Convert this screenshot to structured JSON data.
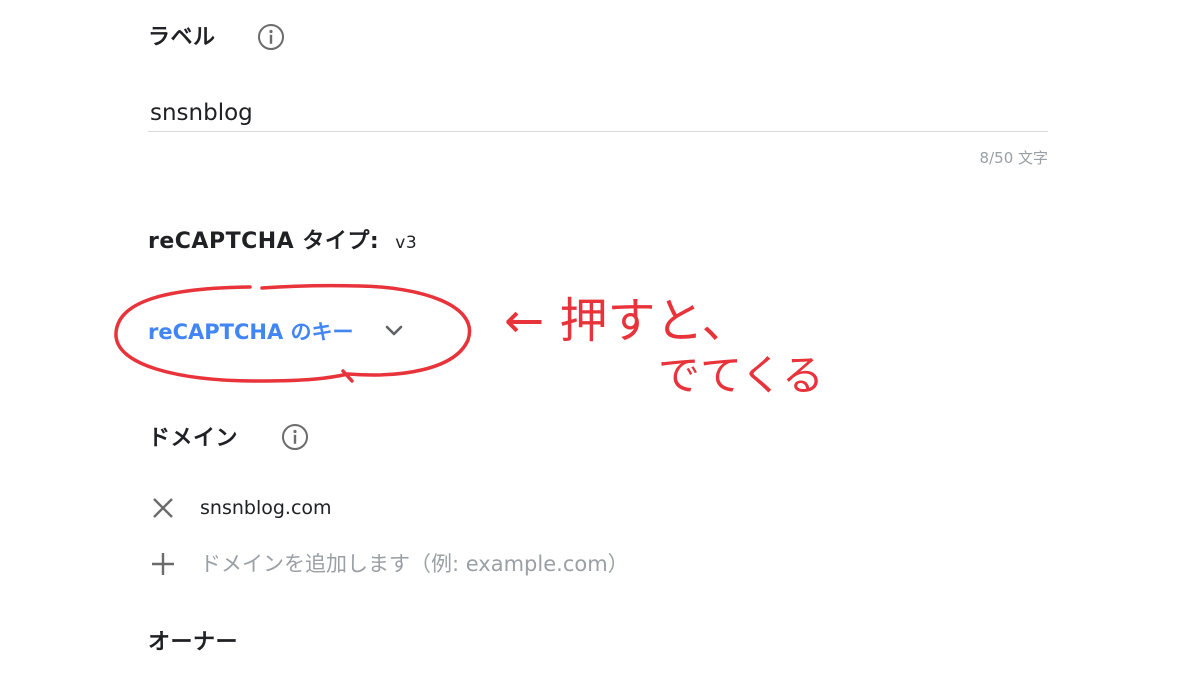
{
  "label_section": {
    "title": "ラベル",
    "value": "snsnblog",
    "counter": "8/50 文字"
  },
  "type_section": {
    "title": "reCAPTCHA タイプ:",
    "value": "v3"
  },
  "keys_section": {
    "label": "reCAPTCHA のキー"
  },
  "domain_section": {
    "title": "ドメイン",
    "domains": [
      "snsnblog.com"
    ],
    "add_placeholder": "ドメインを追加します（例: example.com）"
  },
  "owner_section": {
    "title": "オーナー"
  },
  "annotation": {
    "line1": "← 押すと、",
    "line2": "でてくる",
    "color": "#e8333a"
  },
  "colors": {
    "link": "#4285f4",
    "muted": "#9aa0a6",
    "icon": "#6b6b6b"
  },
  "icons": {
    "info": "info-icon",
    "remove": "close-icon",
    "add": "plus-icon",
    "expand": "chevron-down-icon"
  }
}
